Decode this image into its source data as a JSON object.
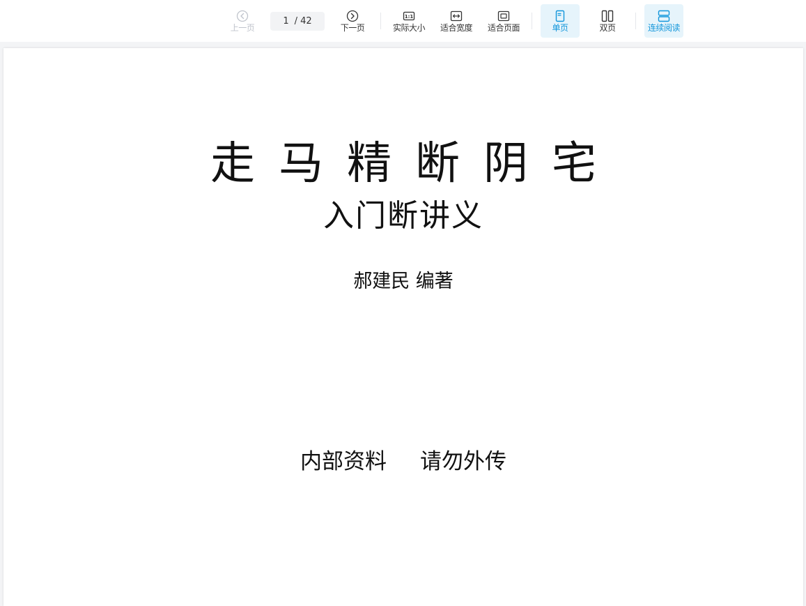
{
  "toolbar": {
    "prev_label": "上一页",
    "next_label": "下一页",
    "page_current": "1",
    "page_separator": "/",
    "page_total": "42",
    "actual_size_label": "实际大小",
    "fit_width_label": "适合宽度",
    "fit_page_label": "适合页面",
    "single_page_label": "单页",
    "double_page_label": "双页",
    "continuous_label": "连续阅读",
    "colors": {
      "active_bg": "#e6f4fb",
      "active_text": "#1296db",
      "disabled_text": "#c0c4cc"
    },
    "icons": {
      "prev": "chevron-left-circle-icon",
      "next": "chevron-right-circle-icon",
      "actual_size": "actual-size-icon",
      "fit_width": "fit-width-icon",
      "fit_page": "fit-page-icon",
      "single_page": "single-page-icon",
      "double_page": "double-page-icon",
      "continuous": "continuous-read-icon"
    }
  },
  "document": {
    "title": "走马精断阴宅",
    "subtitle": "入门断讲义",
    "author": "郝建民 编著",
    "note_left": "内部资料",
    "note_right": "请勿外传"
  }
}
